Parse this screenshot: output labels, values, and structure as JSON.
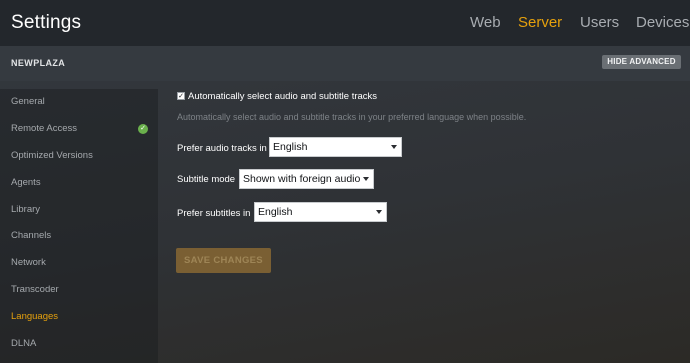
{
  "app": {
    "title": "Settings"
  },
  "top_tabs": [
    {
      "label": "Web",
      "active": false
    },
    {
      "label": "Server",
      "active": true
    },
    {
      "label": "Users",
      "active": false
    },
    {
      "label": "Devices",
      "active": false
    }
  ],
  "server": {
    "name": "NEWPLAZA",
    "hide_advanced_label": "HIDE ADVANCED"
  },
  "sidebar": {
    "items": [
      {
        "label": "General"
      },
      {
        "label": "Remote Access",
        "status_icon": "check-circle-icon"
      },
      {
        "label": "Optimized Versions"
      },
      {
        "label": "Agents"
      },
      {
        "label": "Library"
      },
      {
        "label": "Channels"
      },
      {
        "label": "Network"
      },
      {
        "label": "Transcoder"
      },
      {
        "label": "Languages",
        "active": true
      },
      {
        "label": "DLNA"
      }
    ]
  },
  "main": {
    "auto_select": {
      "checked": true,
      "label": "Automatically select audio and subtitle tracks",
      "help": "Automatically select audio and subtitle tracks in your preferred language when possible."
    },
    "audio_tracks": {
      "label": "Prefer audio tracks in",
      "value": "English"
    },
    "subtitle_mode": {
      "label": "Subtitle mode",
      "value": "Shown with foreign audio"
    },
    "subtitles": {
      "label": "Prefer subtitles in",
      "value": "English"
    },
    "save_label": "SAVE CHANGES"
  },
  "colors": {
    "accent": "#e5a00d",
    "header_bg": "#23272c",
    "status_green": "#6ab04c",
    "save_button_bg": "#7a5f33"
  }
}
